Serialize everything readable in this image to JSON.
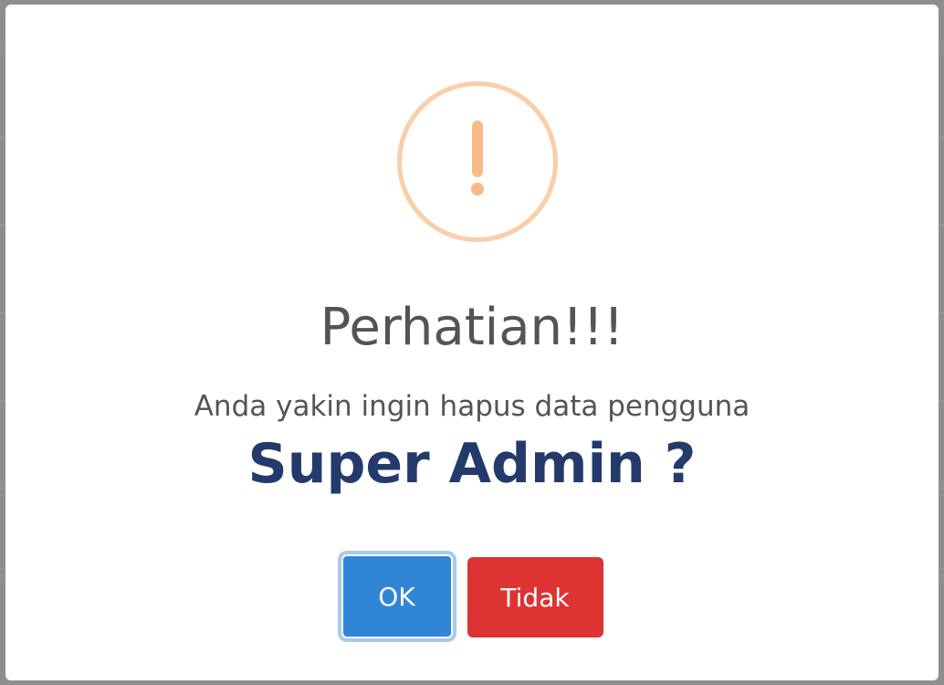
{
  "dialog": {
    "title": "Perhatian!!!",
    "message": "Anda yakin ingin hapus data pengguna",
    "target": "Super Admin ?",
    "icon": "warning-icon",
    "confirm_label": "OK",
    "cancel_label": "Tidak"
  },
  "colors": {
    "icon_ring": "#facea8",
    "icon_mark": "#f8bb86",
    "target_text": "#233a6b",
    "confirm_button": "#3085d6",
    "cancel_button": "#dd3333"
  }
}
